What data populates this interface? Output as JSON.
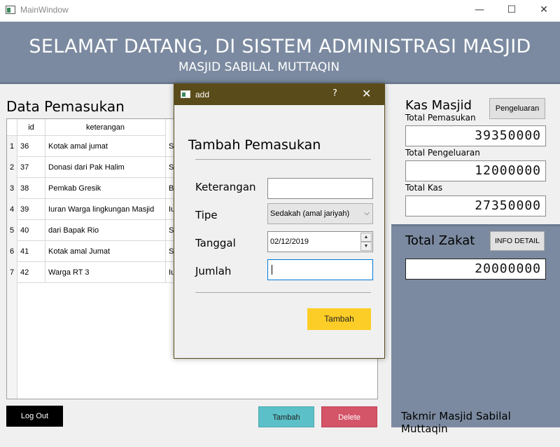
{
  "window": {
    "title": "MainWindow",
    "minimize": "—",
    "maximize": "☐",
    "close": "✕"
  },
  "header": {
    "title": "SELAMAT DATANG, DI SISTEM ADMINISTRASI MASJID",
    "subtitle": "MASJID SABILAL MUTTAQIN"
  },
  "left": {
    "section_title": "Data Pemasukan",
    "columns": [
      "id",
      "keterangan"
    ],
    "rows": [
      {
        "num": "1",
        "id": "36",
        "keterangan": "Kotak amal jumat",
        "tipe": "Se"
      },
      {
        "num": "2",
        "id": "37",
        "keterangan": "Donasi dari Pak Halim",
        "tipe": "Su"
      },
      {
        "num": "3",
        "id": "38",
        "keterangan": "Pemkab Gresik",
        "tipe": "Ba"
      },
      {
        "num": "4",
        "id": "39",
        "keterangan": "Iuran Warga lingkungan Masjid",
        "tipe": "Iu"
      },
      {
        "num": "5",
        "id": "40",
        "keterangan": "dari Bapak Rio",
        "tipe": "Su"
      },
      {
        "num": "6",
        "id": "41",
        "keterangan": "Kotak amal Jumat",
        "tipe": "Se"
      },
      {
        "num": "7",
        "id": "42",
        "keterangan": "Warga RT 3",
        "tipe": "Iu"
      }
    ],
    "logout_label": "Log Out",
    "tambah_label": "Tambah",
    "delete_label": "Delete"
  },
  "right": {
    "kas_title": "Kas Masjid",
    "pengeluaran_label": "Pengeluaran",
    "total_pemasukan_label": "Total Pemasukan",
    "total_pemasukan": "39350000",
    "total_pengeluaran_label": "Total Pengeluaran",
    "total_pengeluaran": "12000000",
    "total_kas_label": "Total Kas",
    "total_kas": "27350000",
    "zakat_title": "Total Zakat",
    "info_detail_label": "INFO DETAIL",
    "total_zakat": "20000000",
    "footer": "Takmir Masjid Sabilal Muttaqin"
  },
  "dialog": {
    "title": "add",
    "help": "?",
    "close": "✕",
    "heading": "Tambah Pemasukan",
    "keterangan_label": "Keterangan",
    "keterangan_value": "",
    "tipe_label": "Tipe",
    "tipe_value": "Sedakah (amal jariyah)",
    "tanggal_label": "Tanggal",
    "tanggal_value": "02/12/2019",
    "jumlah_label": "Jumlah",
    "jumlah_value": "",
    "submit_label": "Tambah"
  },
  "colors": {
    "header_bg": "#7b8aa0",
    "dialog_titlebar": "#5a4b1a",
    "tambah_main": "#5bc0c8",
    "delete_main": "#d45468",
    "dialog_submit": "#fccd26"
  }
}
